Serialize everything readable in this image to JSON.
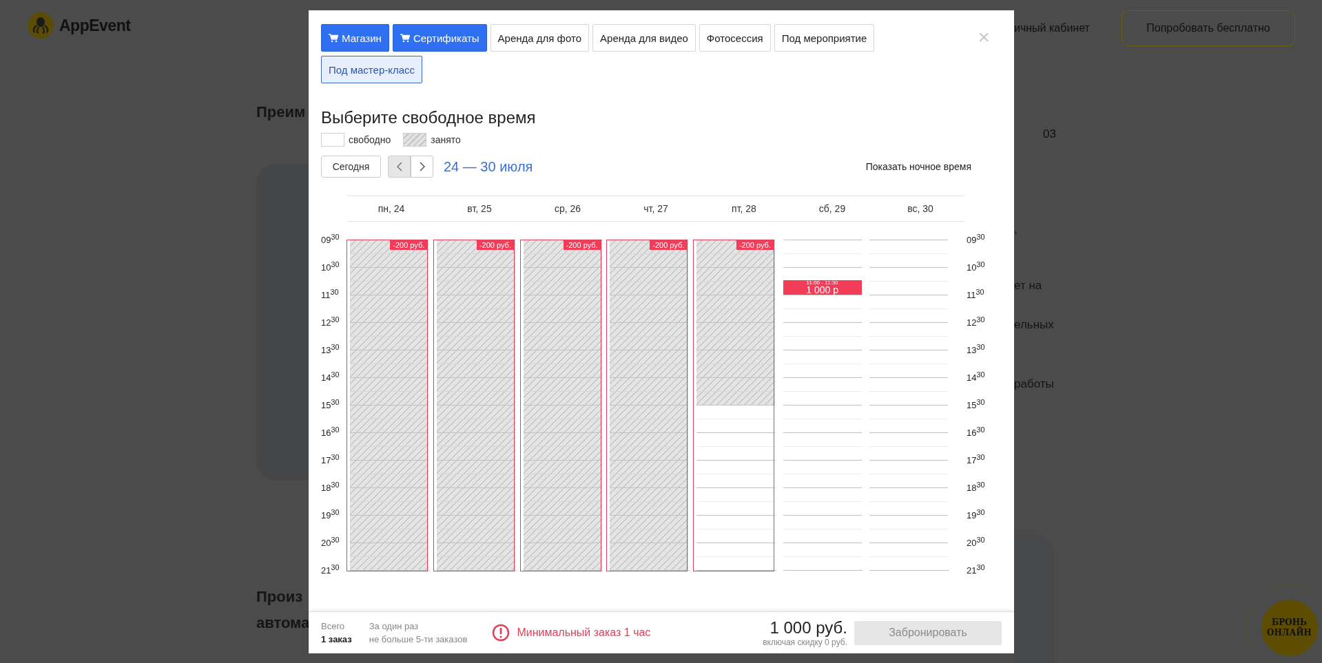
{
  "header": {
    "logo": "AppEvent",
    "account_link": "ичный кабинет",
    "try_button": "Попробовать бесплатно"
  },
  "background": {
    "heading_top": "Преим",
    "counter": "03",
    "fragments": [
      ",",
      "ет на",
      "ельных",
      "работы"
    ],
    "heading_bottom": [
      "Произ",
      "автома"
    ],
    "book_button": "БРОНЬ ОНЛАЙН"
  },
  "modal": {
    "close": "×",
    "tabs": [
      {
        "label": "Магазин",
        "kind": "shop",
        "selected": false
      },
      {
        "label": "Сертификаты",
        "kind": "shop",
        "selected": false
      },
      {
        "label": "Аренда для фото",
        "kind": "service",
        "selected": false
      },
      {
        "label": "Аренда для видео",
        "kind": "service",
        "selected": false
      },
      {
        "label": "Фотосессия",
        "kind": "service",
        "selected": false
      },
      {
        "label": "Под мероприятие",
        "kind": "service",
        "selected": false
      },
      {
        "label": "Под мастер-класс",
        "kind": "service",
        "selected": true
      }
    ],
    "title": "Выберите свободное время",
    "legend": [
      {
        "label": "свободно",
        "kind": "free"
      },
      {
        "label": "занято",
        "kind": "busy"
      }
    ],
    "nav": {
      "today": "Сегодня",
      "range": "24 — 30 июля",
      "night_toggle": "Показать ночное время"
    },
    "times_left": [
      "09$^{30}$",
      "10$^{30}$",
      "11$^{30}$",
      "12$^{30}$",
      "13$^{30}$",
      "14$^{30}$",
      "15$^{30}$",
      "16$^{30}$",
      "17$^{30}$",
      "18$^{30}$",
      "19$^{30}$",
      "20$^{30}$",
      "21$^{30}$"
    ],
    "times_right": [
      "09$^{30}$",
      "10$^{30}$",
      "11$^{30}$",
      "12$^{30}$",
      "13$^{30}$",
      "14$^{30}$",
      "15$^{30}$",
      "16$^{30}$",
      "17$^{30}$",
      "18$^{30}$",
      "19$^{30}$",
      "20$^{30}$",
      "21$^{30}$"
    ],
    "days": [
      {
        "label": "пн, 24",
        "discount": "-200 руб.",
        "hours": [
          {
            "busy": true
          },
          {
            "busy": true
          },
          {
            "busy": true
          },
          {
            "busy": true
          },
          {
            "busy": true
          },
          {
            "busy": true
          },
          {
            "busy": true
          },
          {
            "busy": true
          },
          {
            "busy": true
          },
          {
            "busy": true
          },
          {
            "busy": true
          },
          {
            "busy": true
          }
        ]
      },
      {
        "label": "вт, 25",
        "discount": "-200 руб.",
        "hours": [
          {
            "busy": true
          },
          {
            "busy": true
          },
          {
            "busy": true
          },
          {
            "busy": true
          },
          {
            "busy": true
          },
          {
            "busy": true
          },
          {
            "busy": true
          },
          {
            "busy": true
          },
          {
            "busy": true
          },
          {
            "busy": true
          },
          {
            "busy": true
          },
          {
            "busy": true
          }
        ]
      },
      {
        "label": "ср, 26",
        "discount": "-200 руб.",
        "hours": [
          {
            "busy": true
          },
          {
            "busy": true
          },
          {
            "busy": true
          },
          {
            "busy": true
          },
          {
            "busy": true
          },
          {
            "busy": true
          },
          {
            "busy": true
          },
          {
            "busy": true
          },
          {
            "busy": true
          },
          {
            "busy": true
          },
          {
            "busy": true
          },
          {
            "busy": true
          }
        ]
      },
      {
        "label": "чт, 27",
        "discount": "-200 руб.",
        "hours": [
          {
            "busy": true
          },
          {
            "busy": true
          },
          {
            "busy": true
          },
          {
            "busy": true
          },
          {
            "busy": true
          },
          {
            "busy": true
          },
          {
            "busy": true
          },
          {
            "busy": true
          },
          {
            "busy": true
          },
          {
            "busy": true
          },
          {
            "busy": true
          },
          {
            "busy": true
          }
        ]
      },
      {
        "label": "пт, 28",
        "discount": "-200 руб.",
        "hours": [
          {
            "busy": true
          },
          {
            "busy": true
          },
          {
            "busy": true
          },
          {
            "busy": true
          },
          {
            "busy": true
          },
          {
            "busy": true
          },
          {
            "busy": false
          },
          {
            "busy": false
          },
          {
            "busy": false
          },
          {
            "busy": false
          },
          {
            "busy": false
          },
          {
            "busy": false
          }
        ]
      },
      {
        "label": "сб, 29",
        "hours": [
          {
            "busy": false
          },
          {
            "busy": false,
            "booking": {
              "time": "11:00 - 11:30",
              "price": "1 000 р"
            }
          },
          {
            "busy": false
          },
          {
            "busy": false
          },
          {
            "busy": false
          },
          {
            "busy": false
          },
          {
            "busy": false
          },
          {
            "busy": false
          },
          {
            "busy": false
          },
          {
            "busy": false
          },
          {
            "busy": false
          },
          {
            "busy": false
          }
        ]
      },
      {
        "label": "вс, 30",
        "hours": [
          {
            "busy": false
          },
          {
            "busy": false
          },
          {
            "busy": false
          },
          {
            "busy": false
          },
          {
            "busy": false
          },
          {
            "busy": false
          },
          {
            "busy": false
          },
          {
            "busy": false
          },
          {
            "busy": false
          },
          {
            "busy": false
          },
          {
            "busy": false
          },
          {
            "busy": false
          }
        ]
      }
    ],
    "footer": {
      "total_label": "Всего",
      "total_value": "1 заказ",
      "limit_label": "За один раз",
      "limit_value": "не больше 5-ти заказов",
      "warning": "Минимальный заказ 1 час",
      "price": "1 000 руб.",
      "discount_note": "включая скидку 0 руб.",
      "book_button": "Забронировать",
      "book_disabled": true
    }
  }
}
